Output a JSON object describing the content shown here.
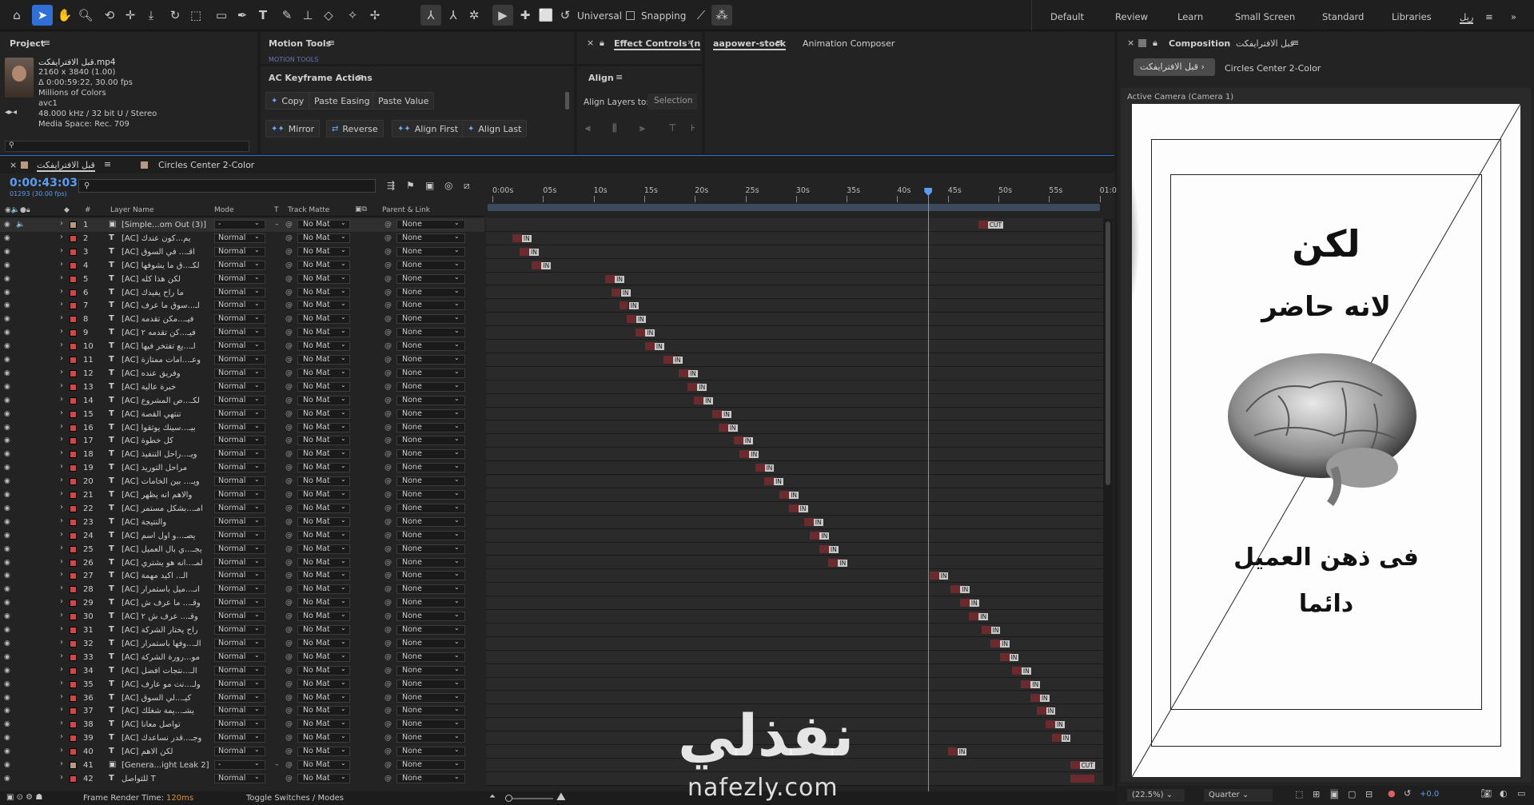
{
  "toolbar": {
    "universal": "Universal",
    "snapping": "Snapping",
    "workspaces": [
      "Default",
      "Review",
      "Learn",
      "Small Screen",
      "Standard",
      "Libraries",
      "ريل"
    ]
  },
  "project": {
    "title": "Project",
    "file": "قبل الافترايفكت.mp4",
    "lines": [
      "2160 x 3840 (1.00)",
      "Δ 0:00:59:22, 30.00 fps",
      "Millions of Colors",
      "avc1",
      "48.000 kHz / 32 bit U / Stereo",
      "Media Space: Rec. 709"
    ]
  },
  "motion_tools": {
    "title": "Motion Tools",
    "sub": "MOTION TOOLS"
  },
  "keyframe": {
    "title": "AC Keyframe Actions",
    "buttons": [
      "Copy",
      "Paste Easing",
      "Paste Value",
      "Mirror",
      "Reverse",
      "Align First",
      "Align Last"
    ]
  },
  "effect_controls": {
    "title": "Effect Controls (n"
  },
  "align": {
    "title": "Align",
    "label": "Align Layers to:",
    "value": "Selection"
  },
  "aapower": {
    "tab1": "aapower-stock",
    "tab2": "Animation Composer"
  },
  "composition": {
    "title": "Composition",
    "name": "قبل الافترايفكت",
    "chip": "قبل الافترايفكت",
    "other": "Circles Center 2-Color",
    "camera": "Active Camera (Camera 1)",
    "zoom": "(22.5%)",
    "quality": "Quarter",
    "exposure": "+0.0",
    "lines": [
      "لكن",
      "لانه حاضر",
      "فى ذهن العميل",
      "دائما"
    ]
  },
  "timeline": {
    "tab1": "قبل الافترايفكت",
    "tab2": "Circles Center 2-Color",
    "time": "0:00:43:03",
    "frames": "01293 (30.00 fps)",
    "search_placeholder": "",
    "headers": {
      "name": "Layer Name",
      "mode": "Mode",
      "t": "T",
      "matte": "Track Matte",
      "parent": "Parent & Link",
      "num": "#"
    },
    "ticks": [
      "0:00s",
      "05s",
      "10s",
      "15s",
      "20s",
      "25s",
      "30s",
      "35s",
      "40s",
      "45s",
      "50s",
      "55s",
      "01:0"
    ],
    "footer": {
      "render": "Frame Render Time:",
      "render_val": "120ms",
      "toggle": "Toggle Switches / Modes"
    },
    "layers": [
      {
        "n": "1",
        "name": "[Simple...om Out (3)]",
        "mode": "-",
        "type": "comp",
        "color": "#b79a86",
        "start": 0.805,
        "end": 0.83,
        "tag": "CUT"
      },
      {
        "n": "2",
        "name": "[AC] يم...كون عندك",
        "mode": "Normal",
        "type": "text",
        "color": "#c94a4a",
        "start": 0.043,
        "end": 0.06,
        "tag": "IN"
      },
      {
        "n": "3",
        "name": "[AC] اقـ... في السوق",
        "mode": "Normal",
        "type": "text",
        "color": "#c94a4a",
        "start": 0.055,
        "end": 0.075,
        "tag": "IN"
      },
      {
        "n": "4",
        "name": "[AC] لكـ...ق ما يشوفها",
        "mode": "Normal",
        "type": "text",
        "color": "#c94a4a",
        "start": 0.075,
        "end": 0.092,
        "tag": "IN"
      },
      {
        "n": "5",
        "name": "[AC] لكن هذا كله",
        "mode": "Normal",
        "type": "text",
        "color": "#c94a4a",
        "start": 0.195,
        "end": 0.21,
        "tag": "IN"
      },
      {
        "n": "6",
        "name": "[AC] ما راح يفيدك",
        "mode": "Normal",
        "type": "text",
        "color": "#c94a4a",
        "start": 0.205,
        "end": 0.22,
        "tag": "IN"
      },
      {
        "n": "7",
        "name": "[AC] اـ...سوق ما عرف",
        "mode": "Normal",
        "type": "text",
        "color": "#c94a4a",
        "start": 0.218,
        "end": 0.232,
        "tag": "IN"
      },
      {
        "n": "8",
        "name": "[AC] فيـ...مكن تقدمه",
        "mode": "Normal",
        "type": "text",
        "color": "#c94a4a",
        "start": 0.23,
        "end": 0.246,
        "tag": "IN"
      },
      {
        "n": "9",
        "name": "[AC] فيـ...كن تقدمه ٢",
        "mode": "Normal",
        "type": "text",
        "color": "#c94a4a",
        "start": 0.245,
        "end": 0.26,
        "tag": "IN"
      },
      {
        "n": "10",
        "name": "[AC] اـ...يع تفتخر فيها",
        "mode": "Normal",
        "type": "text",
        "color": "#c94a4a",
        "start": 0.26,
        "end": 0.28,
        "tag": "IN"
      },
      {
        "n": "11",
        "name": "[AC] وعـ...امات ممتازة",
        "mode": "Normal",
        "type": "text",
        "color": "#c94a4a",
        "start": 0.29,
        "end": 0.31,
        "tag": "IN"
      },
      {
        "n": "12",
        "name": "[AC] وفريق عنده",
        "mode": "Normal",
        "type": "text",
        "color": "#c94a4a",
        "start": 0.315,
        "end": 0.335,
        "tag": "IN"
      },
      {
        "n": "13",
        "name": "[AC] خبرة عالية",
        "mode": "Normal",
        "type": "text",
        "color": "#c94a4a",
        "start": 0.33,
        "end": 0.35,
        "tag": "IN"
      },
      {
        "n": "14",
        "name": "[AC] لكـ...ص المشروع",
        "mode": "Normal",
        "type": "text",
        "color": "#c94a4a",
        "start": 0.34,
        "end": 0.36,
        "tag": "IN"
      },
      {
        "n": "15",
        "name": "[AC] تنتهي القصة",
        "mode": "Normal",
        "type": "text",
        "color": "#c94a4a",
        "start": 0.37,
        "end": 0.39,
        "tag": "IN"
      },
      {
        "n": "16",
        "name": "[AC] بيـ...سينك يوثقوا",
        "mode": "Normal",
        "type": "text",
        "color": "#c94a4a",
        "start": 0.38,
        "end": 0.4,
        "tag": "IN"
      },
      {
        "n": "17",
        "name": "[AC] كل خطوة",
        "mode": "Normal",
        "type": "text",
        "color": "#c94a4a",
        "start": 0.405,
        "end": 0.425,
        "tag": "IN"
      },
      {
        "n": "18",
        "name": "[AC] ويـ...راحل التنفيذ",
        "mode": "Normal",
        "type": "text",
        "color": "#c94a4a",
        "start": 0.415,
        "end": 0.435,
        "tag": "IN"
      },
      {
        "n": "19",
        "name": "[AC] مراحل التوريد",
        "mode": "Normal",
        "type": "text",
        "color": "#c94a4a",
        "start": 0.44,
        "end": 0.46,
        "tag": "IN"
      },
      {
        "n": "20",
        "name": "[AC] ويـ... بين الخامات",
        "mode": "Normal",
        "type": "text",
        "color": "#c94a4a",
        "start": 0.455,
        "end": 0.475,
        "tag": "IN"
      },
      {
        "n": "21",
        "name": "[AC] والاهم انه يظهر",
        "mode": "Normal",
        "type": "text",
        "color": "#c94a4a",
        "start": 0.48,
        "end": 0.5,
        "tag": "IN"
      },
      {
        "n": "22",
        "name": "[AC] امـ...بشكل مستمر",
        "mode": "Normal",
        "type": "text",
        "color": "#c94a4a",
        "start": 0.495,
        "end": 0.515,
        "tag": "IN"
      },
      {
        "n": "23",
        "name": "[AC] والنتيجة",
        "mode": "Normal",
        "type": "text",
        "color": "#c94a4a",
        "start": 0.52,
        "end": 0.54,
        "tag": "IN"
      },
      {
        "n": "24",
        "name": "[AC] يصـ...و اول اسم",
        "mode": "Normal",
        "type": "text",
        "color": "#c94a4a",
        "start": 0.53,
        "end": 0.55,
        "tag": "IN"
      },
      {
        "n": "25",
        "name": "[AC] يجـ...ي بال العميل",
        "mode": "Normal",
        "type": "text",
        "color": "#c94a4a",
        "start": 0.545,
        "end": 0.565,
        "tag": "IN"
      },
      {
        "n": "26",
        "name": "[AC] لمـ...انه هو يشتري",
        "mode": "Normal",
        "type": "text",
        "color": "#c94a4a",
        "start": 0.56,
        "end": 0.58,
        "tag": "IN"
      },
      {
        "n": "27",
        "name": "[AC] الـ.. اكيد مهمة",
        "mode": "Normal",
        "type": "text",
        "color": "#c94a4a",
        "start": 0.725,
        "end": 0.745,
        "tag": "IN"
      },
      {
        "n": "28",
        "name": "[AC] انـ...ميل باستمرار",
        "mode": "Normal",
        "type": "text",
        "color": "#c94a4a",
        "start": 0.76,
        "end": 0.78,
        "tag": "IN"
      },
      {
        "n": "29",
        "name": "[AC] وقـ... ما عرف ش",
        "mode": "Normal",
        "type": "text",
        "color": "#c94a4a",
        "start": 0.775,
        "end": 0.795,
        "tag": "IN"
      },
      {
        "n": "30",
        "name": "[AC] وقـ... عرف ش ٢",
        "mode": "Normal",
        "type": "text",
        "color": "#c94a4a",
        "start": 0.79,
        "end": 0.81,
        "tag": "IN"
      },
      {
        "n": "31",
        "name": "[AC] راح يختار الشركة",
        "mode": "Normal",
        "type": "text",
        "color": "#c94a4a",
        "start": 0.81,
        "end": 0.83,
        "tag": "IN"
      },
      {
        "n": "32",
        "name": "[AC] الـ...وفها باستمرار",
        "mode": "Normal",
        "type": "text",
        "color": "#c94a4a",
        "start": 0.825,
        "end": 0.845,
        "tag": "IN"
      },
      {
        "n": "33",
        "name": "[AC] مو...رورة الشركة",
        "mode": "Normal",
        "type": "text",
        "color": "#c94a4a",
        "start": 0.84,
        "end": 0.86,
        "tag": "IN"
      },
      {
        "n": "34",
        "name": "[AC] الـ...نتجات افضل",
        "mode": "Normal",
        "type": "text",
        "color": "#c94a4a",
        "start": 0.86,
        "end": 0.88,
        "tag": "IN"
      },
      {
        "n": "35",
        "name": "[AC] ولـ...نت مو عارف",
        "mode": "Normal",
        "type": "text",
        "color": "#c94a4a",
        "start": 0.875,
        "end": 0.895,
        "tag": "IN"
      },
      {
        "n": "36",
        "name": "[AC] كيـ...لي السوق",
        "mode": "Normal",
        "type": "text",
        "color": "#c94a4a",
        "start": 0.89,
        "end": 0.91,
        "tag": "IN"
      },
      {
        "n": "37",
        "name": "[AC] يشـ...يمة شغلك",
        "mode": "Normal",
        "type": "text",
        "color": "#c94a4a",
        "start": 0.9,
        "end": 0.925,
        "tag": "IN"
      },
      {
        "n": "38",
        "name": "[AC] تواصل معانا",
        "mode": "Normal",
        "type": "text",
        "color": "#c94a4a",
        "start": 0.915,
        "end": 0.935,
        "tag": "IN"
      },
      {
        "n": "39",
        "name": "[AC] وجـ...قدر نساعدك",
        "mode": "Normal",
        "type": "text",
        "color": "#c94a4a",
        "start": 0.925,
        "end": 0.945,
        "tag": "IN"
      },
      {
        "n": "40",
        "name": "[AC] لكن الاهم",
        "mode": "Normal",
        "type": "text",
        "color": "#c94a4a",
        "start": 0.755,
        "end": 0.77,
        "tag": "IN"
      },
      {
        "n": "41",
        "name": "[Genera...ight Leak 2]",
        "mode": "-",
        "type": "comp",
        "color": "#b79a86",
        "start": 0.955,
        "end": 0.99,
        "tag": "CUT"
      },
      {
        "n": "42",
        "name": "للتواصل T",
        "mode": "Normal",
        "type": "text",
        "color": "#c94a4a",
        "start": 0.955,
        "end": 0.995,
        "tag": ""
      }
    ]
  },
  "watermark": {
    "brand": "نفذلي",
    "url": "nafezly.com"
  },
  "colors": {
    "accent": "#4a90e2",
    "label_red": "#c94a4a",
    "bar": "#6b2b2e"
  }
}
